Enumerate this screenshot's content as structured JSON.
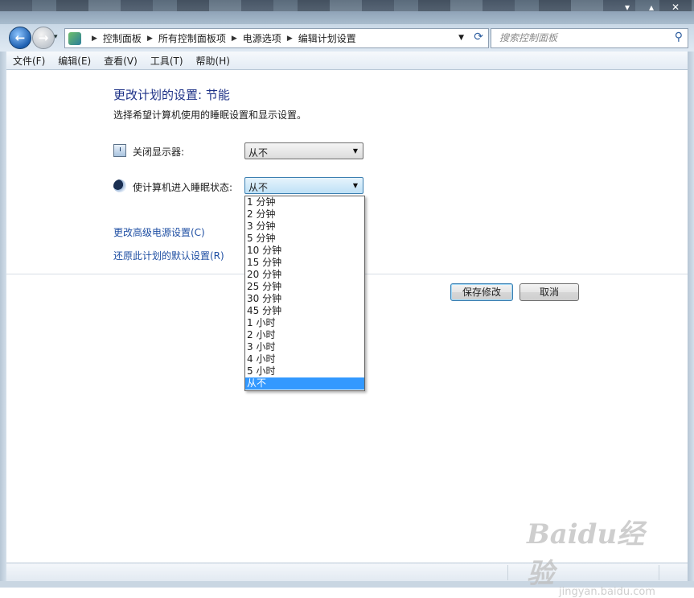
{
  "window": {
    "controls": [
      "▾",
      "▴",
      "✕"
    ]
  },
  "nav": {
    "back_glyph": "←",
    "forward_glyph": "→",
    "recent_glyph": "▾",
    "breadcrumbs": [
      "控制面板",
      "所有控制面板项",
      "电源选项",
      "编辑计划设置"
    ],
    "search_placeholder": "搜索控制面板"
  },
  "menu": [
    "文件(F)",
    "编辑(E)",
    "查看(V)",
    "工具(T)",
    "帮助(H)"
  ],
  "page": {
    "title": "更改计划的设置: 节能",
    "subtitle": "选择希望计算机使用的睡眠设置和显示设置。",
    "display_off_label": "关闭显示器:",
    "display_off_value": "从不",
    "sleep_label": "使计算机进入睡眠状态:",
    "sleep_value": "从不",
    "sleep_options": [
      "1 分钟",
      "2 分钟",
      "3 分钟",
      "5 分钟",
      "10 分钟",
      "15 分钟",
      "20 分钟",
      "25 分钟",
      "30 分钟",
      "45 分钟",
      "1 小时",
      "2 小时",
      "3 小时",
      "4 小时",
      "5 小时",
      "从不"
    ],
    "sleep_selected_index": 15,
    "advanced_link": "更改高级电源设置(C)",
    "restore_link": "还原此计划的默认设置(R)",
    "save_button": "保存修改",
    "cancel_button": "取消"
  },
  "watermark": {
    "main": "Baidu经验",
    "sub": "jingyan.baidu.com"
  },
  "colors": {
    "title": "#1e3287",
    "link": "#1f4fa3",
    "highlight": "#3399ff"
  }
}
